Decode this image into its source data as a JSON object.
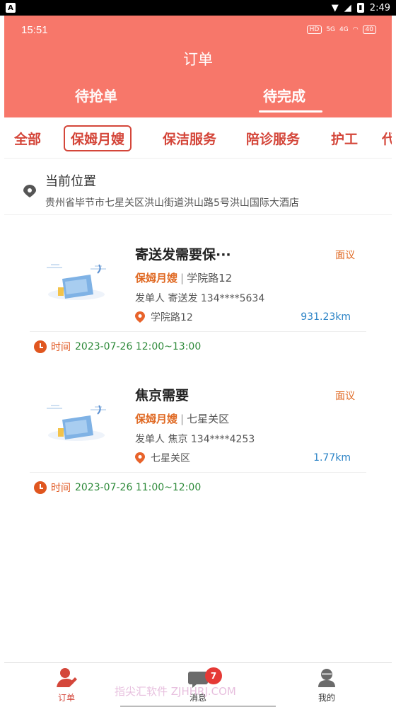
{
  "system_bar": {
    "app_indicator": "A",
    "time": "2:49"
  },
  "inner_status": {
    "time": "15:51",
    "network": "5G",
    "network2": "4G",
    "battery": "40"
  },
  "header": {
    "title": "订单"
  },
  "top_tabs": [
    {
      "label": "待抢单",
      "active": false
    },
    {
      "label": "待完成",
      "active": true
    }
  ],
  "categories": [
    {
      "label": "全部",
      "active": false
    },
    {
      "label": "保姆月嫂",
      "active": true
    },
    {
      "label": "保洁服务",
      "active": false
    },
    {
      "label": "陪诊服务",
      "active": false
    },
    {
      "label": "护工",
      "active": false
    },
    {
      "label": "代",
      "active": false
    }
  ],
  "location": {
    "title": "当前位置",
    "address": "贵州省毕节市七星关区洪山街道洪山路5号洪山国际大酒店"
  },
  "orders": [
    {
      "title": "寄送发需要保···",
      "price": "面议",
      "tag": "保姆月嫂",
      "area": "学院路12",
      "sender": "发单人 寄送发 134****5634",
      "address": "学院路12",
      "distance": "931.23km",
      "time_label": "时间",
      "time_value": "2023-07-26 12:00~13:00"
    },
    {
      "title": "焦京需要",
      "price": "面议",
      "tag": "保姆月嫂",
      "area": "七星关区",
      "sender": "发单人 焦京 134****4253",
      "address": "七星关区",
      "distance": "1.77km",
      "time_label": "时间",
      "time_value": "2023-07-26 11:00~12:00"
    }
  ],
  "tabbar": {
    "items": [
      {
        "label": "订单",
        "icon": "order-icon",
        "active": true
      },
      {
        "label": "消息",
        "icon": "message-icon",
        "badge": "7"
      },
      {
        "label": "我的",
        "icon": "profile-icon"
      }
    ]
  },
  "watermark": "指尖汇软件 ZJHHRJ.COM",
  "colors": {
    "header": "#f7776a",
    "accent": "#d4463a",
    "orange": "#e06a24",
    "green": "#2e8a3a",
    "blue": "#2b83c6"
  }
}
